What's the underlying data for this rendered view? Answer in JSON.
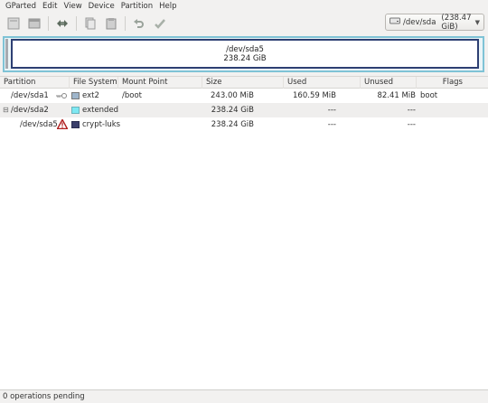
{
  "menubar": {
    "items": [
      "GParted",
      "Edit",
      "View",
      "Device",
      "Partition",
      "Help"
    ]
  },
  "toolbar": {
    "buttons": [
      {
        "icon": "new-partition-icon"
      },
      {
        "icon": "delete-partition-icon"
      },
      {
        "icon": "resize-move-icon"
      },
      {
        "icon": "copy-icon"
      },
      {
        "icon": "paste-icon"
      },
      {
        "icon": "undo-icon"
      },
      {
        "icon": "apply-icon"
      }
    ]
  },
  "device": {
    "name": "/dev/sda",
    "size": "(238.47 GiB)"
  },
  "diskmap": {
    "partition": "/dev/sda5",
    "size": "238.24 GiB"
  },
  "table": {
    "headers": {
      "partition": "Partition",
      "filesystem": "File System",
      "mountpoint": "Mount Point",
      "size": "Size",
      "used": "Used",
      "unused": "Unused",
      "flags": "Flags"
    },
    "rows": [
      {
        "partition": "/dev/sda1",
        "indicator": "key-icon",
        "filesystem": "ext2",
        "fs_color": "#9fb6cc",
        "mountpoint": "/boot",
        "size": "243.00 MiB",
        "used": "160.59 MiB",
        "unused": "82.41 MiB",
        "flags": "boot"
      },
      {
        "partition": "/dev/sda2",
        "indicator": "",
        "filesystem": "extended",
        "fs_color": "#7ee8f2",
        "mountpoint": "",
        "size": "238.24 GiB",
        "used": "---",
        "unused": "---",
        "flags": ""
      },
      {
        "partition": "/dev/sda5",
        "indicator": "warning-icon",
        "filesystem": "crypt-luks",
        "fs_color": "#3a3f6b",
        "mountpoint": "",
        "size": "238.24 GiB",
        "used": "---",
        "unused": "---",
        "flags": ""
      }
    ]
  },
  "status": {
    "text": "0 operations pending"
  }
}
